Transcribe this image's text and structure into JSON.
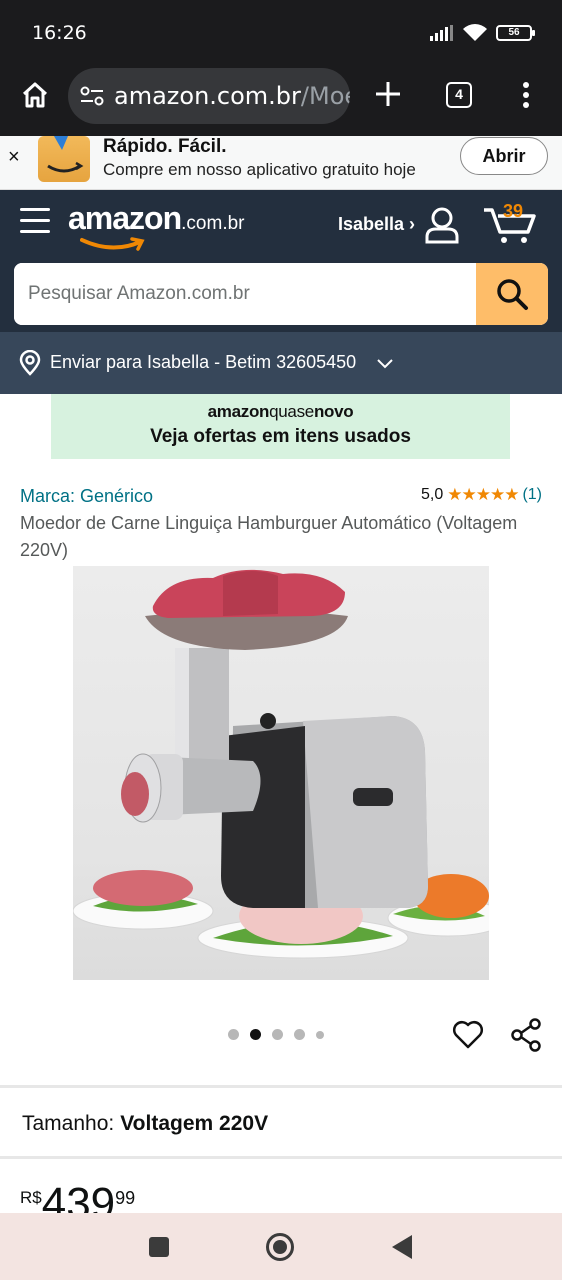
{
  "status_bar": {
    "time": "16:26",
    "battery": "56"
  },
  "browser": {
    "url_main": "amazon.com.br",
    "url_path": "/Moe",
    "tab_count": "4"
  },
  "app_banner": {
    "title": "Rápido. Fácil.",
    "subtitle": "Compre em nosso aplicativo gratuito hoje",
    "open_label": "Abrir",
    "close_label": "×"
  },
  "header": {
    "logo_text": "amazon",
    "logo_suffix": ".com.br",
    "account_label": "Isabella ›",
    "cart_count": "39",
    "search_placeholder": "Pesquisar Amazon.com.br"
  },
  "delivery": {
    "text": "Enviar para Isabella - Betim 32605450"
  },
  "promo": {
    "brand_prefix": "amazon",
    "brand_mid": "quase",
    "brand_bold": "novo",
    "text": "Veja ofertas em itens usados"
  },
  "product": {
    "brand": "Marca: Genérico",
    "rating_value": "5,0",
    "stars": "★★★★★",
    "rating_count": "(1)",
    "title": "Moedor de Carne Linguiça Hamburguer Automático (Voltagem 220V)",
    "image_alt": "Moedor de carne elétrico",
    "image_dots": 5,
    "active_dot": 1,
    "size_label": "Tamanho:",
    "size_value": "Voltagem 220V",
    "price_currency": "R$",
    "price_whole": "439",
    "price_fraction": "99"
  },
  "colors": {
    "header_bg": "#232f3e",
    "delivery_bg": "#37475a",
    "search_button": "#febd69",
    "link": "#007185",
    "star": "#f08804",
    "promo_bg": "#d7f2df"
  },
  "icons": [
    "home-icon",
    "tune-icon",
    "plus-icon",
    "tabs-icon",
    "more-vert-icon",
    "menu-icon",
    "account-icon",
    "cart-icon",
    "search-icon",
    "location-pin-icon",
    "chevron-down-icon",
    "heart-icon",
    "share-icon"
  ]
}
